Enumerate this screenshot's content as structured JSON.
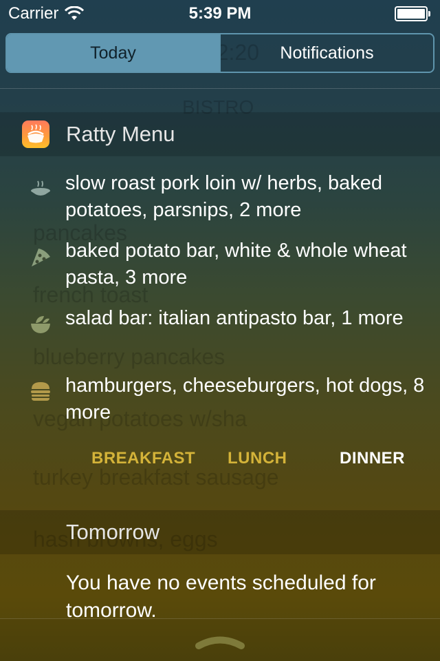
{
  "status_bar": {
    "carrier": "Carrier",
    "time": "5:39 PM",
    "wifi_icon": "wifi-icon",
    "battery_icon": "battery-icon"
  },
  "segmented_control": {
    "tabs": [
      {
        "label": "Today",
        "selected": true
      },
      {
        "label": "Notifications",
        "selected": false
      }
    ]
  },
  "background_ghost": {
    "lines": [
      "Today, Sunday, 2:20",
      "BISTRO",
      "pancakes",
      "french toast",
      "blueberry pancakes",
      "vegan       potatoes w/sha",
      "turkey breakfast sausage",
      "hash browns, eggs"
    ]
  },
  "widget": {
    "app_icon": "ratty-menu-app-icon",
    "title": "Ratty Menu",
    "items": [
      {
        "icon": "soup-bowl-icon",
        "text": "slow roast pork loin w/ herbs, baked potatoes, parsnips, 2 more"
      },
      {
        "icon": "pizza-slice-icon",
        "text": "baked potato bar, white & whole wheat pasta, 3 more"
      },
      {
        "icon": "salad-bowl-icon",
        "text": "salad bar: italian antipasto bar, 1 more"
      },
      {
        "icon": "hamburger-icon",
        "text": "hamburgers, cheeseburgers, hot dogs, 8 more"
      }
    ],
    "meals": {
      "breakfast": "BREAKFAST",
      "lunch": "LUNCH",
      "dinner": "DINNER",
      "selected": "DINNER"
    },
    "colors": {
      "accent": "#d4b339",
      "selected": "#ffffff"
    }
  },
  "tomorrow": {
    "title": "Tomorrow",
    "message": "You have no events scheduled for tomorrow."
  },
  "bottom": {
    "grabber_icon": "chevron-up-icon"
  }
}
